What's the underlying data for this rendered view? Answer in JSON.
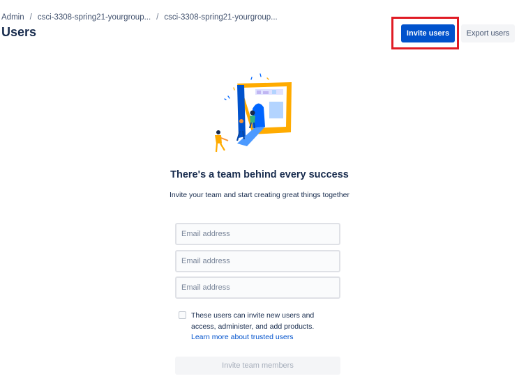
{
  "breadcrumb": {
    "items": [
      "Admin",
      "csci-3308-spring21-yourgroup...",
      "csci-3308-spring21-yourgroup..."
    ],
    "separator": "/"
  },
  "header": {
    "title": "Users",
    "invite_users_label": "Invite users",
    "export_users_label": "Export users"
  },
  "empty_state": {
    "illustration_icon": "team-illustration",
    "headline": "There's a team behind every success",
    "subline": "Invite your team and start creating great things together"
  },
  "invite_form": {
    "email_fields": [
      {
        "placeholder": "Email address",
        "value": ""
      },
      {
        "placeholder": "Email address",
        "value": ""
      },
      {
        "placeholder": "Email address",
        "value": ""
      }
    ],
    "trusted_checkbox_checked": false,
    "trusted_checkbox_label": "These users can invite new users and access, administer, and add products.",
    "learn_more_link": "Learn more about trusted users",
    "submit_label": "Invite team members",
    "submit_disabled": true
  },
  "colors": {
    "primary": "#0052cc",
    "highlight": "#e01b24",
    "text": "#172b4d"
  }
}
